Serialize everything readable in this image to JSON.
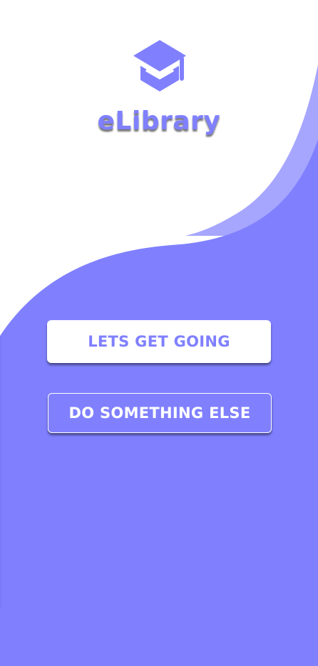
{
  "app": {
    "title": "eLibrary",
    "logo_icon": "graduation-cap-icon"
  },
  "actions": {
    "primary_label": "LETS GET GOING",
    "secondary_label": "DO SOMETHING ELSE"
  },
  "colors": {
    "accent": "#8080ff",
    "accent_light": "#a6a6ff",
    "background": "#ffffff",
    "button_text_on_white": "#8080ff",
    "button_text_on_accent": "#ffffff"
  }
}
